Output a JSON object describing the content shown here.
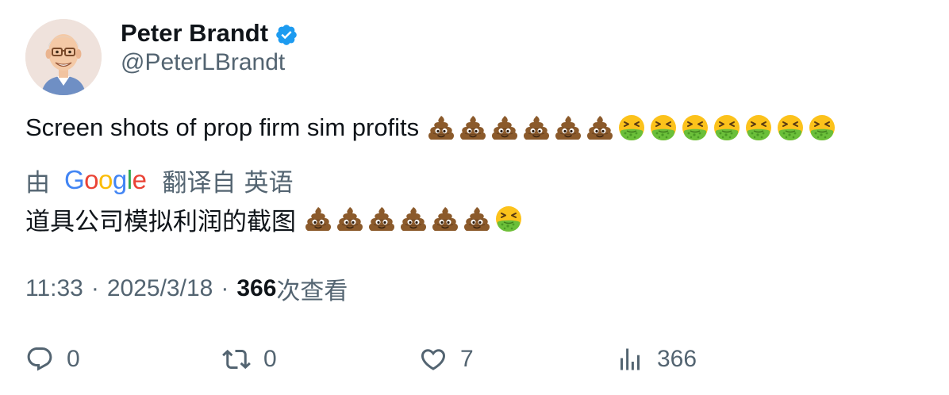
{
  "author": {
    "display_name": "Peter Brandt",
    "handle": "@PeterLBrandt",
    "verified_icon": "verified-badge-icon",
    "verified_color": "#1d9bf0"
  },
  "tweet": {
    "text": "Screen shots of prop firm sim profits",
    "emojis": [
      "poop",
      "poop",
      "poop",
      "poop",
      "poop",
      "poop",
      "nauseated",
      "nauseated",
      "nauseated",
      "nauseated",
      "nauseated",
      "nauseated",
      "nauseated"
    ]
  },
  "translation": {
    "prefix": "由",
    "provider_logo_text": "Google",
    "provider_logo_colors": [
      "#4285F4",
      "#EA4335",
      "#FBBC05",
      "#4285F4",
      "#34A853",
      "#EA4335"
    ],
    "label": "翻译自",
    "source_language": "英语",
    "text": "道具公司模拟利润的截图",
    "emojis": [
      "poop",
      "poop",
      "poop",
      "poop",
      "poop",
      "poop",
      "nauseated"
    ]
  },
  "meta": {
    "time": "11:33",
    "separator": "·",
    "date": "2025/3/18",
    "views_count": "366",
    "views_label": "次查看"
  },
  "actions": {
    "reply": {
      "icon": "reply-icon",
      "count": "0"
    },
    "retweet": {
      "icon": "retweet-icon",
      "count": "0"
    },
    "like": {
      "icon": "heart-icon",
      "count": "7"
    },
    "views": {
      "icon": "analytics-icon",
      "count": "366"
    }
  },
  "colors": {
    "text_primary": "#0f1419",
    "text_secondary": "#536471",
    "accent": "#1d9bf0",
    "background": "#ffffff"
  }
}
